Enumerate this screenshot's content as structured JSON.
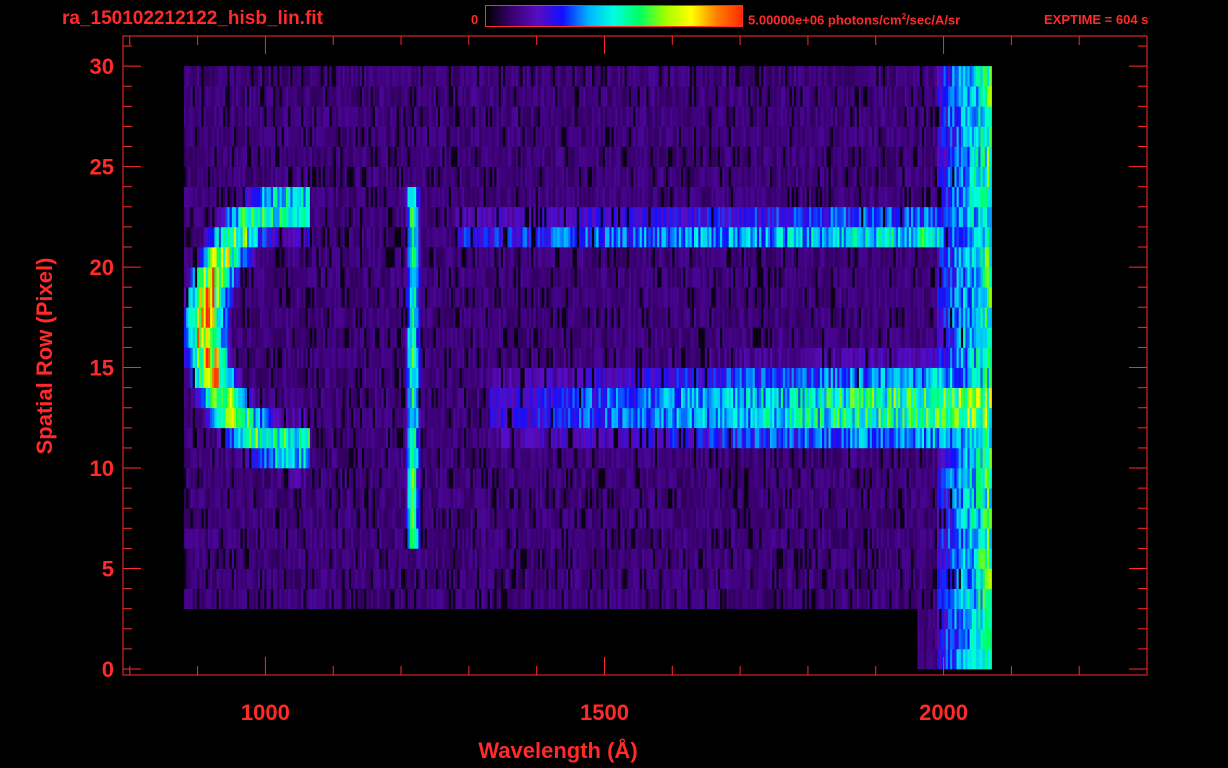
{
  "header": {
    "filename": "ra_150102212122_hisb_lin.fit",
    "colorbar_min": "0",
    "colorbar_max_value": "5.00000e+06 photons/cm",
    "colorbar_max_sup": "2",
    "colorbar_max_rest": "/sec/A/sr",
    "exptime": "EXPTIME = 604 s"
  },
  "colors": {
    "axis": "#ff2a2a",
    "background": "#000000",
    "colormap": [
      "#000000",
      "#3a0070",
      "#5a0cc0",
      "#1010ff",
      "#00b4ff",
      "#00ffe0",
      "#00ff60",
      "#a0ff00",
      "#ffff00",
      "#ff8000",
      "#ff2a00"
    ]
  },
  "chart_data": {
    "type": "heatmap",
    "title": "",
    "xlabel": "Wavelength (Å)",
    "ylabel": "Spatial Row (Pixel)",
    "xlim": [
      790,
      2300
    ],
    "ylim": [
      -0.3,
      31.5
    ],
    "xticks": [
      1000,
      1500,
      2000
    ],
    "yticks": [
      0,
      5,
      10,
      15,
      20,
      25,
      30
    ],
    "colorbar_range": [
      0,
      5000000
    ],
    "colorbar_units": "photons/cm^2/sec/A/sr",
    "data_extent_x": [
      880,
      2070
    ],
    "data_extent_y": [
      0,
      30
    ],
    "features": [
      {
        "label": "arc",
        "x_range": [
          900,
          1060
        ],
        "y_range": [
          11,
          23
        ],
        "peak_fraction": 0.9
      },
      {
        "label": "vertical line",
        "x": 1216,
        "y_range": [
          6,
          24
        ],
        "peak_fraction": 0.6
      },
      {
        "label": "upper band",
        "x_range": [
          1280,
          2000
        ],
        "y_range": [
          21,
          23
        ],
        "peak_fraction": 0.55
      },
      {
        "label": "lower band",
        "x_range": [
          1330,
          2070
        ],
        "y_range": [
          11,
          15
        ],
        "peak_fraction": 0.65
      }
    ],
    "grid": false
  }
}
